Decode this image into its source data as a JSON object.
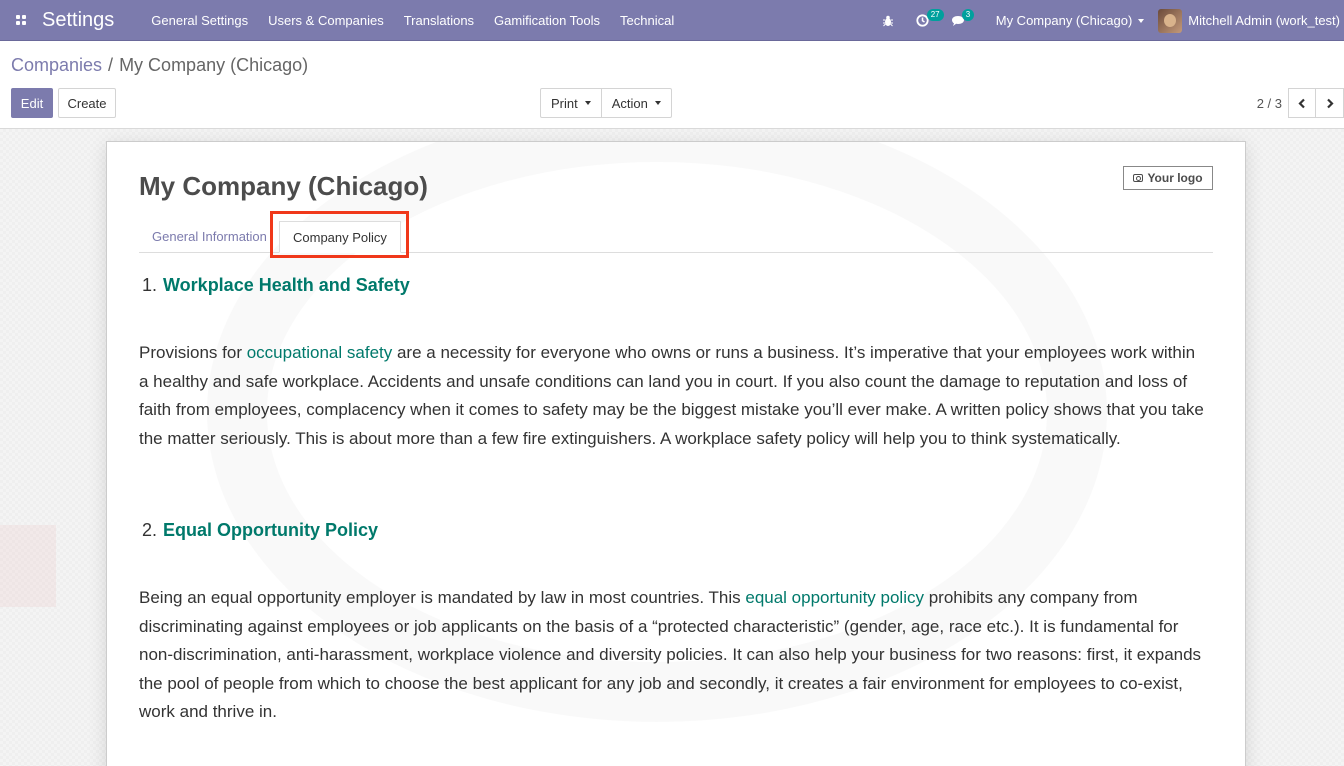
{
  "navbar": {
    "app_title": "Settings",
    "menu": [
      "General Settings",
      "Users & Companies",
      "Translations",
      "Gamification Tools",
      "Technical"
    ],
    "activity_count": "27",
    "message_count": "3",
    "company_switch": "My Company (Chicago)",
    "user_name": "Mitchell Admin (work_test)"
  },
  "breadcrumb": {
    "parent": "Companies",
    "current": "My Company (Chicago)"
  },
  "buttons": {
    "edit": "Edit",
    "create": "Create",
    "print": "Print",
    "action": "Action"
  },
  "pager": {
    "value": "2 / 3",
    "prev_icon": "chevron-left-icon",
    "next_icon": "chevron-right-icon"
  },
  "form": {
    "company_name": "My Company (Chicago)",
    "logo_label": "Your logo",
    "tabs": [
      "General Information",
      "Company Policy"
    ],
    "active_tab": "Company Policy",
    "highlight_color": "#f0381a"
  },
  "policies": [
    {
      "number": "1.",
      "title": "Workplace Health and Safety",
      "pre": "Provisions for ",
      "link": "occupational safety",
      "post": " are a necessity for everyone who owns or runs a business. It’s imperative that your employees work within a healthy and safe workplace. Accidents and unsafe conditions can land you in court. If you also count the damage to reputation and loss of faith from employees, complacency when it comes to safety may be the biggest mistake you’ll ever make. A written policy shows that you take the matter seriously. This is about more than a few fire extinguishers. A workplace safety policy will help you to think systematically."
    },
    {
      "number": "2.",
      "title": "Equal Opportunity Policy",
      "pre": "Being an equal opportunity employer is mandated by law in most countries. This ",
      "link": "equal opportunity policy",
      "post": " prohibits any company from discriminating against employees or job applicants on the basis of a “protected characteristic” (gender, age, race etc.). It is fundamental for non-discrimination, anti-harassment, workplace violence and diversity policies. It can also help your business for two reasons: first, it expands the pool of people from which to choose the best applicant for any job and secondly, it creates a fair environment for employees to co-exist, work and thrive in."
    }
  ],
  "colors": {
    "brand": "#7c7bad",
    "link": "#00796b",
    "badge": "#00a09d"
  }
}
